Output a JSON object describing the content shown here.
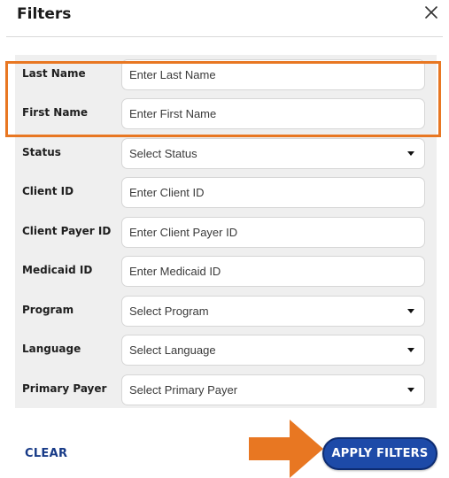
{
  "header": {
    "title": "Filters",
    "close_icon": "close-icon"
  },
  "filters": [
    {
      "label": "Last Name",
      "kind": "input",
      "placeholder": "Enter Last Name"
    },
    {
      "label": "First Name",
      "kind": "input",
      "placeholder": "Enter First Name"
    },
    {
      "label": "Status",
      "kind": "select",
      "value": "Select Status"
    },
    {
      "label": "Client ID",
      "kind": "input",
      "placeholder": "Enter Client ID"
    },
    {
      "label": "Client Payer ID",
      "kind": "input",
      "placeholder": "Enter Client Payer ID"
    },
    {
      "label": "Medicaid ID",
      "kind": "input",
      "placeholder": "Enter Medicaid ID"
    },
    {
      "label": "Program",
      "kind": "select",
      "value": "Select Program"
    },
    {
      "label": "Language",
      "kind": "select",
      "value": "Select Language"
    },
    {
      "label": "Primary Payer",
      "kind": "select",
      "value": "Select Primary Payer"
    }
  ],
  "footer": {
    "clear_label": "CLEAR",
    "apply_label": "APPLY FILTERS"
  },
  "colors": {
    "highlight": "#e87722",
    "primary": "#1d4aa8",
    "link": "#173a87",
    "panel": "#efefef"
  }
}
